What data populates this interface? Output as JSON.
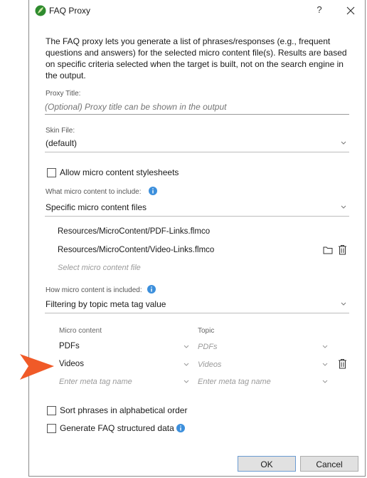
{
  "window": {
    "title": "FAQ Proxy",
    "help": "?"
  },
  "intro": "The FAQ proxy lets you generate a list of phrases/responses (e.g., frequent questions and answers) for the selected micro content file(s). Results are based on specific criteria selected when the target is built, not on the search engine in the output.",
  "proxy_title": {
    "label": "Proxy Title:",
    "placeholder": "(Optional) Proxy title can be shown in the output",
    "value": ""
  },
  "skin_file": {
    "label": "Skin File:",
    "value": "(default)"
  },
  "allow_stylesheets": {
    "label": "Allow micro content stylesheets",
    "checked": false
  },
  "include_what": {
    "label": "What micro content to include:",
    "value": "Specific micro content files"
  },
  "files": [
    "Resources/MicroContent/PDF-Links.flmco",
    "Resources/MicroContent/Video-Links.flmco"
  ],
  "select_file_placeholder": "Select micro content file",
  "include_how": {
    "label": "How micro content is included:",
    "value": "Filtering by topic meta tag value"
  },
  "filter_table": {
    "col_micro": "Micro content",
    "col_topic": "Topic",
    "rows": [
      {
        "micro": "PDFs",
        "topic": "PDFs"
      },
      {
        "micro": "Videos",
        "topic": "Videos"
      }
    ],
    "new_row": {
      "micro_placeholder": "Enter meta tag name",
      "topic_placeholder": "Enter meta tag name"
    }
  },
  "sort_alpha": {
    "label": "Sort phrases in alphabetical order",
    "checked": false
  },
  "structured_data": {
    "label": "Generate FAQ structured data",
    "checked": false
  },
  "buttons": {
    "ok": "OK",
    "cancel": "Cancel"
  },
  "colors": {
    "accent": "#3c8fdc",
    "arrow": "#f05a28",
    "logo": "#2e8b2e"
  }
}
